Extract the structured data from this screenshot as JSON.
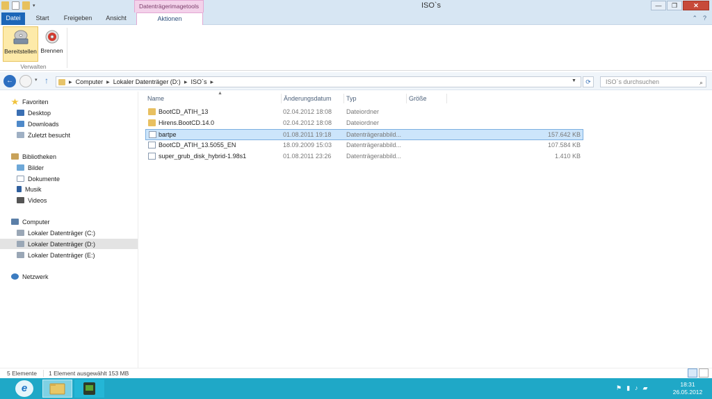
{
  "window": {
    "title": "ISO`s",
    "context_group": "Datenträgerimagetools",
    "controls": {
      "minimize": "—",
      "maximize": "❐",
      "close": "✕"
    }
  },
  "ribbon": {
    "tabs": {
      "file": "Datei",
      "start": "Start",
      "share": "Freigeben",
      "view": "Ansicht",
      "actions": "Aktionen"
    },
    "help_icons": [
      "⌃",
      "?"
    ],
    "buttons": {
      "mount": "Bereitstellen",
      "burn": "Brennen"
    },
    "group_label": "Verwalten"
  },
  "address": {
    "crumbs": [
      "Computer",
      "Lokaler Datenträger (D:)",
      "ISO`s"
    ],
    "search_placeholder": "ISO`s durchsuchen"
  },
  "navigation": {
    "favorites": {
      "header": "Favoriten",
      "items": [
        "Desktop",
        "Downloads",
        "Zuletzt besucht"
      ]
    },
    "libraries": {
      "header": "Bibliotheken",
      "items": [
        "Bilder",
        "Dokumente",
        "Musik",
        "Videos"
      ]
    },
    "computer": {
      "header": "Computer",
      "items": [
        "Lokaler Datenträger (C:)",
        "Lokaler Datenträger (D:)",
        "Lokaler Datenträger (E:)"
      ],
      "selected_index": 1
    },
    "network": {
      "header": "Netzwerk"
    }
  },
  "file_list": {
    "columns": {
      "name": "Name",
      "date": "Änderungsdatum",
      "type": "Typ",
      "size": "Größe"
    },
    "rows": [
      {
        "name": "BootCD_ATIH_13",
        "date": "02.04.2012 18:08",
        "type": "Dateiordner",
        "size": "",
        "icon": "folder-icon",
        "selected": false
      },
      {
        "name": "Hirens.BootCD.14.0",
        "date": "02.04.2012 18:08",
        "type": "Dateiordner",
        "size": "",
        "icon": "folder-icon",
        "selected": false
      },
      {
        "name": "bartpe",
        "date": "01.08.2011 19:18",
        "type": "Datenträgerabbild...",
        "size": "157.642 KB",
        "icon": "iso-file-icon",
        "selected": true
      },
      {
        "name": "BootCD_ATIH_13.5055_EN",
        "date": "18.09.2009 15:03",
        "type": "Datenträgerabbild...",
        "size": "107.584 KB",
        "icon": "iso-file-icon",
        "selected": false
      },
      {
        "name": "super_grub_disk_hybrid-1.98s1",
        "date": "01.08.2011 23:26",
        "type": "Datenträgerabbild...",
        "size": "1.410 KB",
        "icon": "iso-file-icon",
        "selected": false
      }
    ]
  },
  "status": {
    "count": "5 Elemente",
    "selection": "1 Element ausgewählt  153 MB"
  },
  "taskbar": {
    "start_glyph": "e",
    "clock": {
      "time": "18:31",
      "date": "26.05.2012"
    },
    "tray_icons": [
      "flag-icon",
      "signal-icon",
      "speaker-icon",
      "network-icon"
    ],
    "accent": "#1fa8c7"
  }
}
